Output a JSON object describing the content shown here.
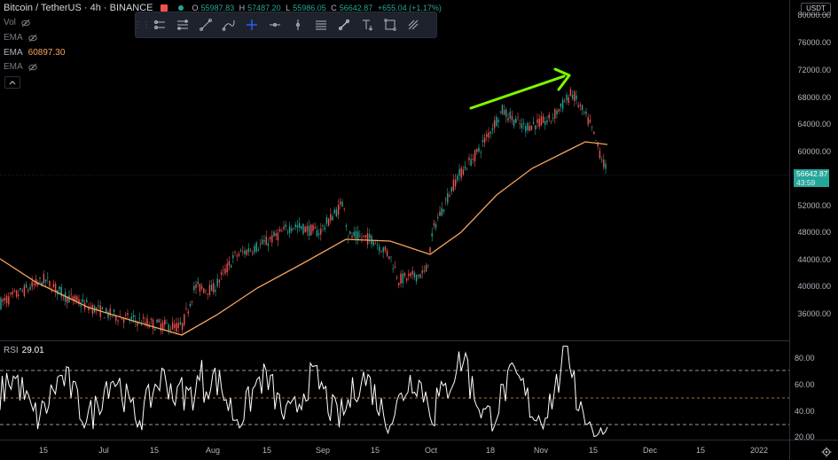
{
  "header": {
    "symbol": "Bitcoin / TetherUS · 4h · BINANCE",
    "ohlc": {
      "o_key": "O",
      "o": "55987.83",
      "h_key": "H",
      "h": "57487.20",
      "l_key": "L",
      "l": "55986.05",
      "c_key": "C",
      "c": "56642.87",
      "change": "+655.04 (+1.17%)"
    }
  },
  "indicators": [
    {
      "name": "Vol",
      "value": ""
    },
    {
      "name": "EMA",
      "value": ""
    },
    {
      "name": "EMA",
      "value": "60897.30"
    },
    {
      "name": "EMA",
      "value": ""
    }
  ],
  "toolbar_icons": [
    "horizontal-ray-icon",
    "parallel-channel-icon",
    "trend-line-icon",
    "path-icon",
    "crosshair-icon",
    "horizontal-line-icon",
    "vertical-line-icon",
    "lines-icon",
    "brush-icon",
    "text-icon",
    "rectangle-icon",
    "fullscreen-icon"
  ],
  "price_axis": {
    "currency": "USDT",
    "labels": [
      "80000.00",
      "76000.00",
      "72000.00",
      "68000.00",
      "64000.00",
      "60000.00",
      "52000.00",
      "48000.00",
      "44000.00",
      "40000.00",
      "36000.00"
    ],
    "current_price": "56642.87",
    "countdown": "43:59"
  },
  "time_axis": [
    "15",
    "Jul",
    "15",
    "Aug",
    "15",
    "Sep",
    "15",
    "Oct",
    "18",
    "Nov",
    "15",
    "Dec",
    "15",
    "2022"
  ],
  "rsi": {
    "label": "RSI",
    "value": "29.01",
    "axis": [
      "80.00",
      "60.00",
      "40.00",
      "20.00"
    ]
  },
  "colors": {
    "up": "#26a69a",
    "down": "#ef5350",
    "ema": "#f7a35c",
    "arrow": "#7cfc00",
    "rsi_line": "#ffffff"
  }
}
